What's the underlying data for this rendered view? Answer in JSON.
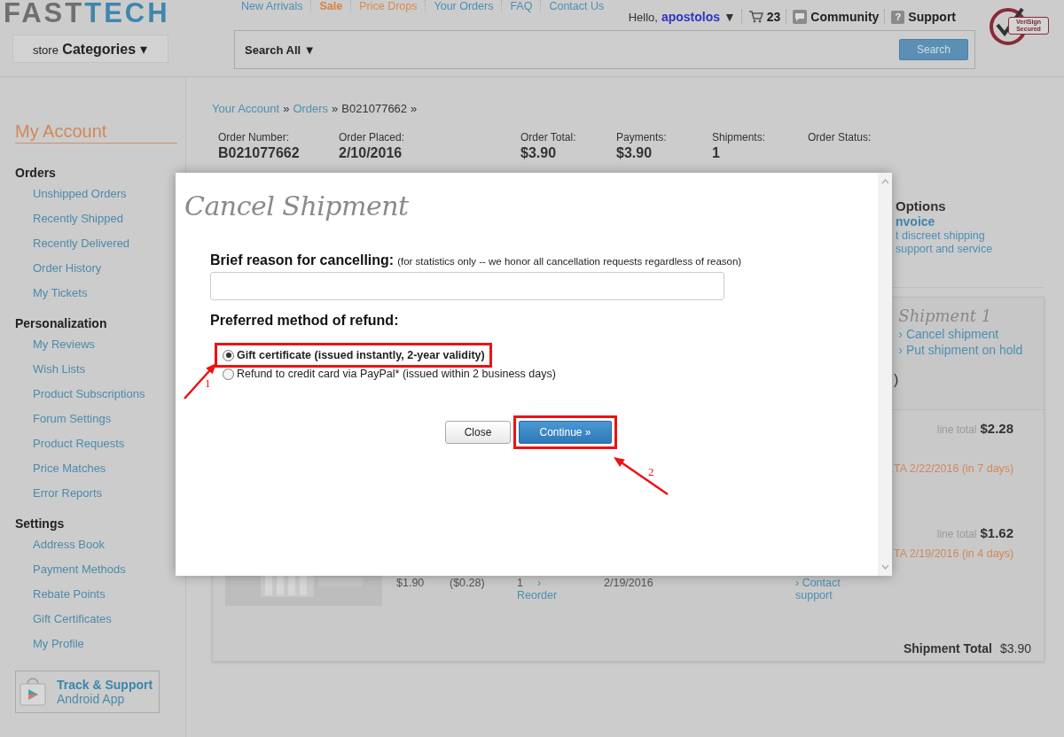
{
  "header": {
    "logo": [
      {
        "text": "FAST",
        "kind": "dark"
      },
      {
        "text": "TECH",
        "kind": "accent"
      }
    ],
    "nav": [
      {
        "label": "New Arrivals",
        "kind": "link"
      },
      {
        "label": "Sale",
        "kind": "sale"
      },
      {
        "label": "Price Drops",
        "kind": "promo"
      },
      {
        "label": "Your Orders",
        "kind": "link"
      },
      {
        "label": "FAQ",
        "kind": "link"
      },
      {
        "label": "Contact Us",
        "kind": "link"
      }
    ],
    "greeting": "Hello,",
    "username": "apostolos",
    "user_caret": "▼",
    "cart_count": "23",
    "community": "Community",
    "support_icon": "?",
    "support": "Support",
    "badge": "VeriSign Secured",
    "categories": {
      "prefix": "store",
      "label": "Categories",
      "caret": "▾"
    },
    "search": {
      "scope": "Search All ▼",
      "button": "Search"
    }
  },
  "sidebar": {
    "title": "My Account",
    "sections": [
      {
        "heading": "Orders",
        "items": [
          "Unshipped Orders",
          "Recently Shipped",
          "Recently Delivered",
          "Order History",
          "My Tickets"
        ]
      },
      {
        "heading": "Personalization",
        "items": [
          "My Reviews",
          "Wish Lists",
          "Product Subscriptions",
          "Forum Settings",
          "Product Requests",
          "Price Matches",
          "Error Reports"
        ]
      },
      {
        "heading": "Settings",
        "items": [
          "Address Book",
          "Payment Methods",
          "Rebate Points",
          "Gift Certificates",
          "My Profile"
        ]
      }
    ],
    "app_promo": {
      "title": "Track & Support",
      "subtitle": "Android App"
    }
  },
  "breadcrumb": [
    {
      "label": "Your Account",
      "kind": "link",
      "after": "»"
    },
    {
      "label": "Orders",
      "kind": "link",
      "after": "»"
    },
    {
      "label": "B021077662",
      "kind": "current",
      "after": "»"
    }
  ],
  "summary": [
    {
      "label": "Order Number:",
      "value": "B021077662"
    },
    {
      "label": "Order Placed:",
      "value": "2/10/2016"
    },
    {
      "label": "Order Total:",
      "value": "$3.90"
    },
    {
      "label": "Payments:",
      "value": "$3.90"
    },
    {
      "label": "Shipments:",
      "value": "1"
    },
    {
      "label": "Order Status:"
    }
  ],
  "options_panel": {
    "title": "Options",
    "link": "nvoice",
    "lines": [
      "t discreet shipping",
      "support and service"
    ]
  },
  "shipment": {
    "title": "Shipment 1",
    "actions": [
      "› Cancel shipment",
      "› Put shipment on hold"
    ],
    "fragment": ")",
    "items": [
      {
        "line_total_label": "line total",
        "line_total": "$2.28",
        "eta": "TA 2/22/2016 (in 7 days)"
      },
      {
        "line_total_label": "line total",
        "line_total": "$1.62",
        "eta": "TA 2/19/2016 (in 4 days)",
        "price": "$1.90",
        "discount": "($0.28)",
        "qty": "1",
        "qty_link": "›",
        "reorder": "Reorder",
        "ship_date": "2/19/2016",
        "contact": "› Contact support"
      }
    ],
    "total_label": "Shipment Total",
    "total": "$3.90"
  },
  "modal": {
    "title": "Cancel Shipment",
    "reason": {
      "label": "Brief reason for cancelling:",
      "note": "(for statistics only -- we honor all cancellation requests regardless of reason)"
    },
    "refund_heading": "Preferred method of refund:",
    "options": [
      {
        "label": "Gift certificate (issued instantly, 2-year validity)",
        "selected": true,
        "highlighted": true
      },
      {
        "label": "Refund to credit card via PayPal* (issued within 2 business days)",
        "selected": false,
        "highlighted": false
      }
    ],
    "buttons": [
      {
        "label": "Close",
        "kind": "secondary",
        "highlighted": false
      },
      {
        "label": "Continue »",
        "kind": "primary",
        "highlighted": true
      }
    ]
  },
  "annotations": [
    {
      "label": "1"
    },
    {
      "label": "2"
    }
  ]
}
